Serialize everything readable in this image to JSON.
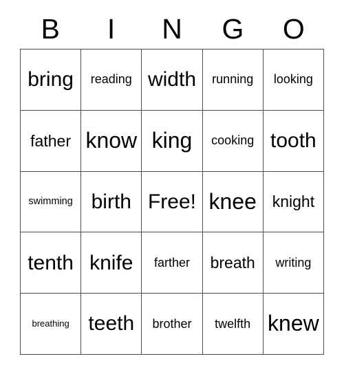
{
  "card": {
    "title": "BINGO",
    "header_letters": [
      "B",
      "I",
      "N",
      "G",
      "O"
    ],
    "grid_colors": {
      "border": "#4a4a4a",
      "background": "#ffffff",
      "text": "#000000"
    },
    "free_space_label": "Free!",
    "rows": [
      {
        "cells": [
          {
            "label": "bring"
          },
          {
            "label": "reading"
          },
          {
            "label": "width"
          },
          {
            "label": "running"
          },
          {
            "label": "looking"
          }
        ]
      },
      {
        "cells": [
          {
            "label": "father"
          },
          {
            "label": "know"
          },
          {
            "label": "king"
          },
          {
            "label": "cooking"
          },
          {
            "label": "tooth"
          }
        ]
      },
      {
        "cells": [
          {
            "label": "swimming"
          },
          {
            "label": "birth"
          },
          {
            "label": "Free!"
          },
          {
            "label": "knee"
          },
          {
            "label": "knight"
          }
        ]
      },
      {
        "cells": [
          {
            "label": "tenth"
          },
          {
            "label": "knife"
          },
          {
            "label": "farther"
          },
          {
            "label": "breath"
          },
          {
            "label": "writing"
          }
        ]
      },
      {
        "cells": [
          {
            "label": "breathing"
          },
          {
            "label": "teeth"
          },
          {
            "label": "brother"
          },
          {
            "label": "twelfth"
          },
          {
            "label": "knew"
          }
        ]
      }
    ]
  }
}
